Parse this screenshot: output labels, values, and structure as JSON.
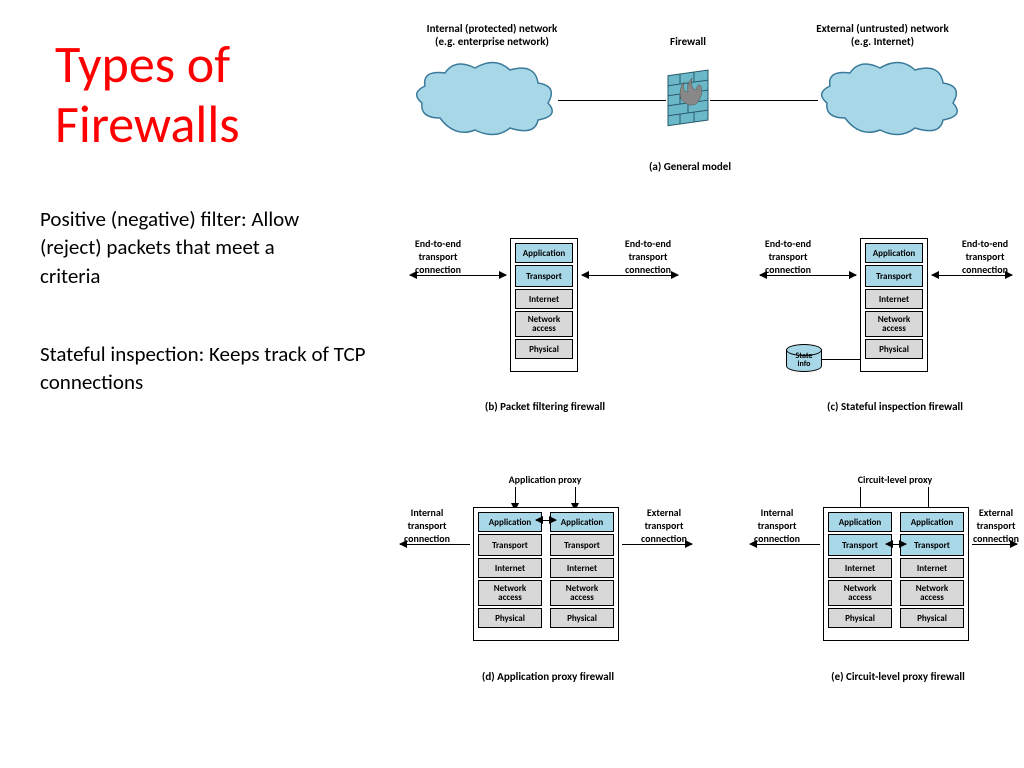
{
  "title_line1": "Types of",
  "title_line2": "Firewalls",
  "desc1": "Positive (negative) filter: Allow (reject) packets that meet a criteria",
  "desc2": "Stateful inspection: Keeps track of TCP connections",
  "a": {
    "internal_lbl": "Internal (protected) network\n(e.g. enterprise network)",
    "firewall_lbl": "Firewall",
    "external_lbl": "External (untrusted) network\n(e.g. Internet)",
    "caption": "(a) General model"
  },
  "conn": {
    "end": "End-to-end\ntransport\nconnection",
    "internal": "Internal\ntransport\nconnection",
    "external": "External\ntransport\nconnection"
  },
  "layers": [
    "Application",
    "Transport",
    "Internet",
    "Network\naccess",
    "Physical"
  ],
  "b": {
    "caption": "(b) Packet filtering firewall"
  },
  "c": {
    "caption": "(c) Stateful inspection firewall",
    "state": "State\ninfo"
  },
  "d": {
    "caption": "(d) Application proxy firewall",
    "proxy": "Application proxy"
  },
  "e": {
    "caption": "(e) Circuit-level proxy firewall",
    "proxy": "Circuit-level proxy"
  }
}
